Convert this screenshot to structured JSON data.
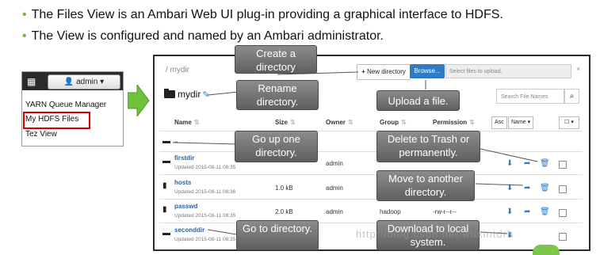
{
  "bullets": [
    "The Files View is an Ambari Web UI plug-in providing a graphical interface to HDFS.",
    "The View is configured and named by an Ambari administrator."
  ],
  "mini_menu": {
    "admin_label": "admin",
    "items": [
      "YARN Queue Manager",
      "My HDFS Files",
      "Tez View"
    ],
    "highlighted": "My HDFS Files"
  },
  "toolbar": {
    "breadcrumb": "/ mydir",
    "new_directory_label": "New directory",
    "browse_label": "Browse...",
    "upload_placeholder": "Select files to upload.",
    "close_label": "×"
  },
  "directory": {
    "title": "mydir",
    "search_placeholder": "Search File Names"
  },
  "columns": {
    "name": "Name",
    "size": "Size",
    "owner": "Owner",
    "group": "Group",
    "permission": "Permission",
    "asc": "Asc",
    "sort_select": "Name"
  },
  "rows": [
    {
      "name": "..",
      "updated": "",
      "size": "",
      "owner": "",
      "group": "",
      "permission": "",
      "type": "folder"
    },
    {
      "name": "firstdir",
      "updated": "Updated 2015-08-11 08:35",
      "size": "",
      "owner": "admin",
      "group": "",
      "permission": "",
      "type": "folder"
    },
    {
      "name": "hosts",
      "updated": "Updated 2015-08-11 08:36",
      "size": "1.0 kB",
      "owner": "admin",
      "group": "",
      "permission": "",
      "type": "file"
    },
    {
      "name": "passwd",
      "updated": "Updated 2015-08-11 08:35",
      "size": "2.0 kB",
      "owner": "admin",
      "group": "hadoop",
      "permission": "-rw-r--r--",
      "type": "file"
    },
    {
      "name": "seconddir",
      "updated": "Updated 2015-08-11 08:35",
      "size": "",
      "owner": "",
      "group": "",
      "permission": "",
      "type": "folder"
    }
  ],
  "callouts": {
    "create_directory": "Create a directory",
    "rename_directory": "Rename directory.",
    "upload_file": "Upload a file.",
    "go_up": "Go up one directory.",
    "delete": "Delete to Trash or permanently.",
    "move": "Move to another directory.",
    "go_to": "Go to directory.",
    "download": "Download to local system."
  },
  "watermark": "http://blog.csdn.net/wuxintdrh",
  "colors": {
    "accent": "#2f7bc4",
    "bullet": "#6fb83a",
    "highlight": "#d00000",
    "callout": "#6e6e6e"
  }
}
